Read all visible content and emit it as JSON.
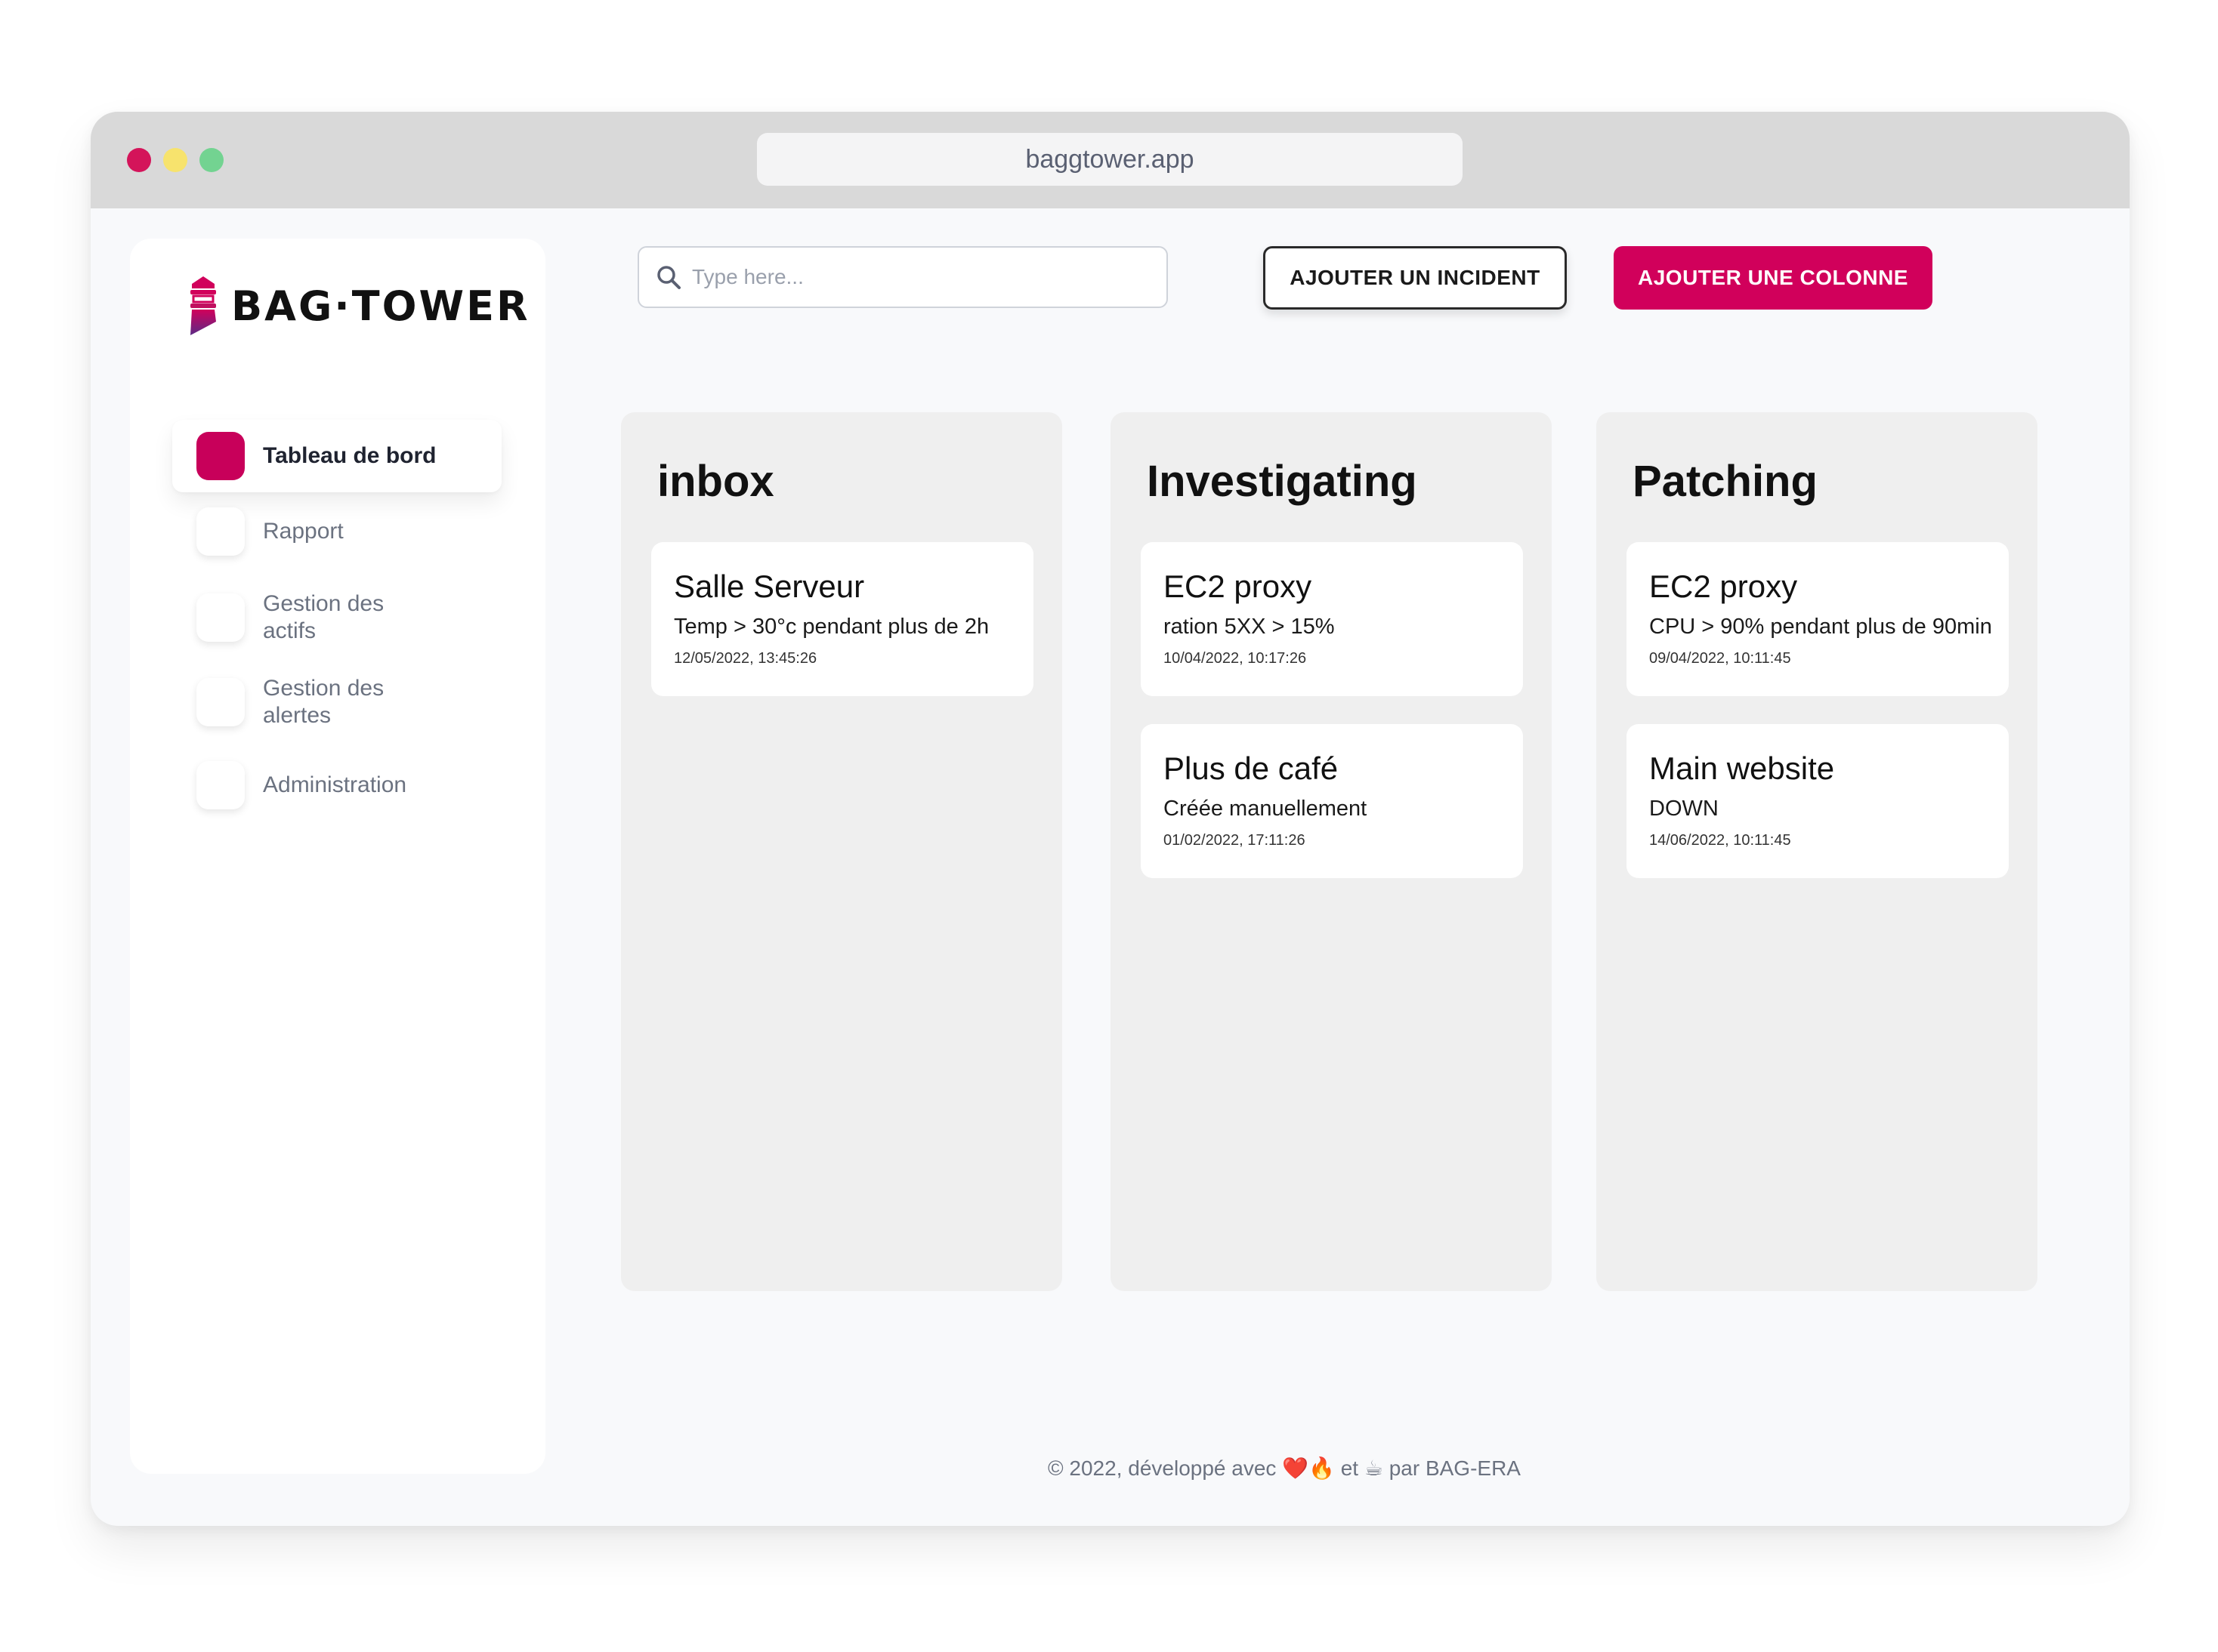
{
  "browser": {
    "url": "baggtower.app"
  },
  "sidebar": {
    "logo_text": "BAG·TOWER",
    "items": [
      {
        "label": "Tableau de bord",
        "active": true
      },
      {
        "label": "Rapport",
        "active": false
      },
      {
        "label": "Gestion des actifs",
        "active": false
      },
      {
        "label": "Gestion des alertes",
        "active": false
      },
      {
        "label": "Administration",
        "active": false
      }
    ]
  },
  "toolbar": {
    "search_placeholder": "Type here...",
    "add_incident_label": "AJOUTER UN INCIDENT",
    "add_column_label": "AJOUTER UNE COLONNE"
  },
  "board": {
    "columns": [
      {
        "title": "inbox",
        "cards": [
          {
            "title": "Salle Serveur",
            "description": "Temp > 30°c pendant plus de 2h",
            "date": "12/05/2022, 13:45:26"
          }
        ]
      },
      {
        "title": "Investigating",
        "cards": [
          {
            "title": "EC2 proxy",
            "description": "ration 5XX > 15%",
            "date": "10/04/2022, 10:17:26"
          },
          {
            "title": "Plus de café",
            "description": "Créée manuellement",
            "date": "01/02/2022, 17:11:26"
          }
        ]
      },
      {
        "title": "Patching",
        "cards": [
          {
            "title": "EC2 proxy",
            "description": "CPU > 90% pendant plus de 90min",
            "date": "09/04/2022, 10:11:45"
          },
          {
            "title": "Main website",
            "description": "DOWN",
            "date": "14/06/2022, 10:11:45"
          }
        ]
      }
    ]
  },
  "footer": {
    "text": "© 2022, développé  avec ❤️🔥 et  ☕ par BAG-ERA"
  },
  "colors": {
    "brand": "#d1005b",
    "window_dot_red": "#d4145a",
    "window_dot_yellow": "#f7e36d",
    "window_dot_green": "#73d391",
    "column_bg": "#efefef"
  },
  "icons": {
    "search": "search-icon",
    "logo": "lighthouse-logo-icon"
  }
}
